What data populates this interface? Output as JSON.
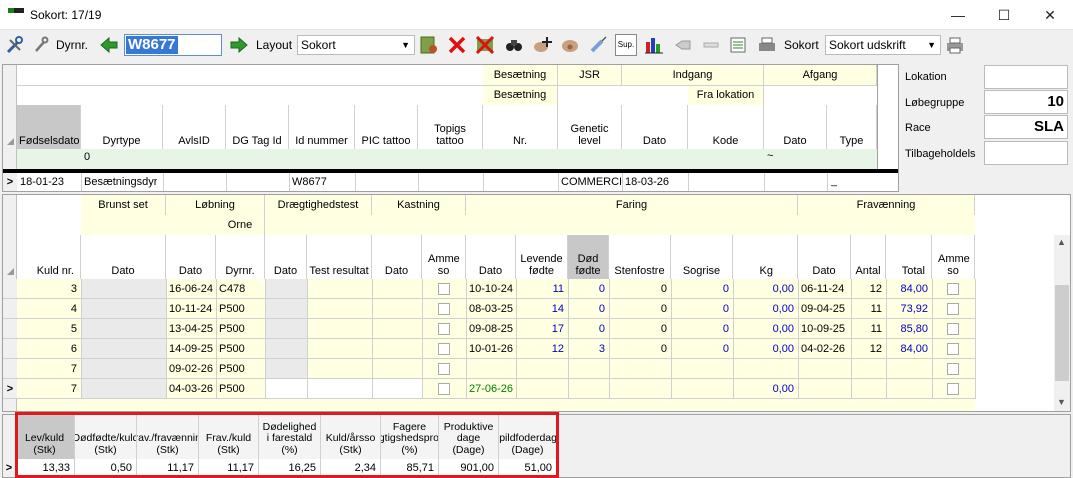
{
  "window": {
    "title": "Sokort: 17/19",
    "minimize_glyph": "—",
    "maximize_glyph": "☐",
    "close_glyph": "✕"
  },
  "toolbar": {
    "dyrnr_label": "Dyrnr.",
    "animal_value": "W8677",
    "layout_label": "Layout",
    "layout_value": "Sokort",
    "sup_label": "Sup.",
    "sokort_label": "Sokort",
    "sokort_value": "Sokort udskrift"
  },
  "animal_grid": {
    "group1": {
      "besaetning": "Besætning",
      "jsr": "JSR",
      "indgang": "Indgang",
      "afgang": "Afgang"
    },
    "group2": {
      "besaetning": "Besætning",
      "fra_lokation": "Fra lokation"
    },
    "columns": [
      "Fødselsdato",
      "Dyrtype",
      "AvlsID",
      "DG Tag Id",
      "Id nummer",
      "PIC tattoo",
      "Topigs tattoo",
      "Nr.",
      "Genetic level",
      "Dato",
      "Kode",
      "Dato",
      "Type"
    ],
    "filter_value": "0",
    "filter_tilde": "~",
    "row": {
      "marker": ">",
      "fodselsdato": "18-01-23",
      "dyrtype": "Besætningsdyr",
      "id_nummer": "W8677",
      "genetic": "COMMERCI",
      "indgang_dato": "18-03-26",
      "afgang_type": "_"
    }
  },
  "right_panel": {
    "lokation_label": "Lokation",
    "lokation_value": "",
    "lobegruppe_label": "Løbegruppe",
    "lobegruppe_value": "10",
    "race_label": "Race",
    "race_value": "SLA",
    "tilbageholds_label": "Tilbageholdels",
    "tilbageholds_value": ""
  },
  "litter_grid": {
    "groups": {
      "brunst": "Brunst set",
      "lobning": "Løbning",
      "orne": "Orne",
      "draegtighed": "Drægtighedstest",
      "kastning": "Kastning",
      "faring": "Faring",
      "fravaenning": "Fravænning"
    },
    "columns": [
      "Kuld nr.",
      "Dato",
      "Dato",
      "Dyrnr.",
      "Dato",
      "Test resultat",
      "Dato",
      "Amme so",
      "Dato",
      "Levende fødte",
      "Død fødte",
      "Stenfostre",
      "Sogrise",
      "Kg",
      "Dato",
      "Antal",
      "Total",
      "Amme so"
    ],
    "rows": [
      {
        "marker": "",
        "kuld": "3",
        "lob_dato": "16-06-24",
        "dyrnr": "C478",
        "far_dato": "10-10-24",
        "levende": "11",
        "dod": "0",
        "sten": "0",
        "sogrise": "0",
        "kg": "0,00",
        "frav_dato": "06-11-24",
        "antal": "12",
        "total": "84,00"
      },
      {
        "marker": "",
        "kuld": "4",
        "lob_dato": "10-11-24",
        "dyrnr": "P500",
        "far_dato": "08-03-25",
        "levende": "14",
        "dod": "0",
        "sten": "0",
        "sogrise": "0",
        "kg": "0,00",
        "frav_dato": "09-04-25",
        "antal": "11",
        "total": "73,92"
      },
      {
        "marker": "",
        "kuld": "5",
        "lob_dato": "13-04-25",
        "dyrnr": "P500",
        "far_dato": "09-08-25",
        "levende": "17",
        "dod": "0",
        "sten": "0",
        "sogrise": "0",
        "kg": "0,00",
        "frav_dato": "10-09-25",
        "antal": "11",
        "total": "85,80"
      },
      {
        "marker": "",
        "kuld": "6",
        "lob_dato": "14-09-25",
        "dyrnr": "P500",
        "far_dato": "10-01-26",
        "levende": "12",
        "dod": "3",
        "sten": "0",
        "sogrise": "0",
        "kg": "0,00",
        "frav_dato": "04-02-26",
        "antal": "12",
        "total": "84,00"
      },
      {
        "marker": "",
        "kuld": "7",
        "lob_dato": "09-02-26",
        "dyrnr": "P500",
        "far_dato": "",
        "levende": "",
        "dod": "",
        "sten": "",
        "sogrise": "",
        "kg": "",
        "frav_dato": "",
        "antal": "",
        "total": ""
      },
      {
        "marker": ">",
        "kuld": "7",
        "lob_dato": "04-03-26",
        "dyrnr": "P500",
        "far_dato": "27-06-26",
        "levende": "",
        "dod": "",
        "sten": "",
        "sogrise": "",
        "kg": "0,00",
        "frav_dato": "",
        "antal": "",
        "total": ""
      }
    ]
  },
  "summary": {
    "columns": [
      "Lev/kuld (Stk)",
      "Dødfødte/kuld (Stk)",
      "Frav./fravænning (Stk)",
      "Frav./kuld (Stk)",
      "Dødelighed i farestald (%)",
      "Kuld/årsso (Stk)",
      "Fagere drægtigshedsprocent (%)",
      "Produktive dage (Dage)",
      "Spildfoderdage (Dage)"
    ],
    "marker": ">",
    "values": [
      "13,33",
      "0,50",
      "11,17",
      "11,17",
      "16,25",
      "2,34",
      "85,71",
      "901,00",
      "51,00"
    ]
  },
  "colors": {
    "accent": "#3778d4",
    "highlight": "#e0191e",
    "yellow": "#ffffe1",
    "green": "#e6f5e6"
  }
}
